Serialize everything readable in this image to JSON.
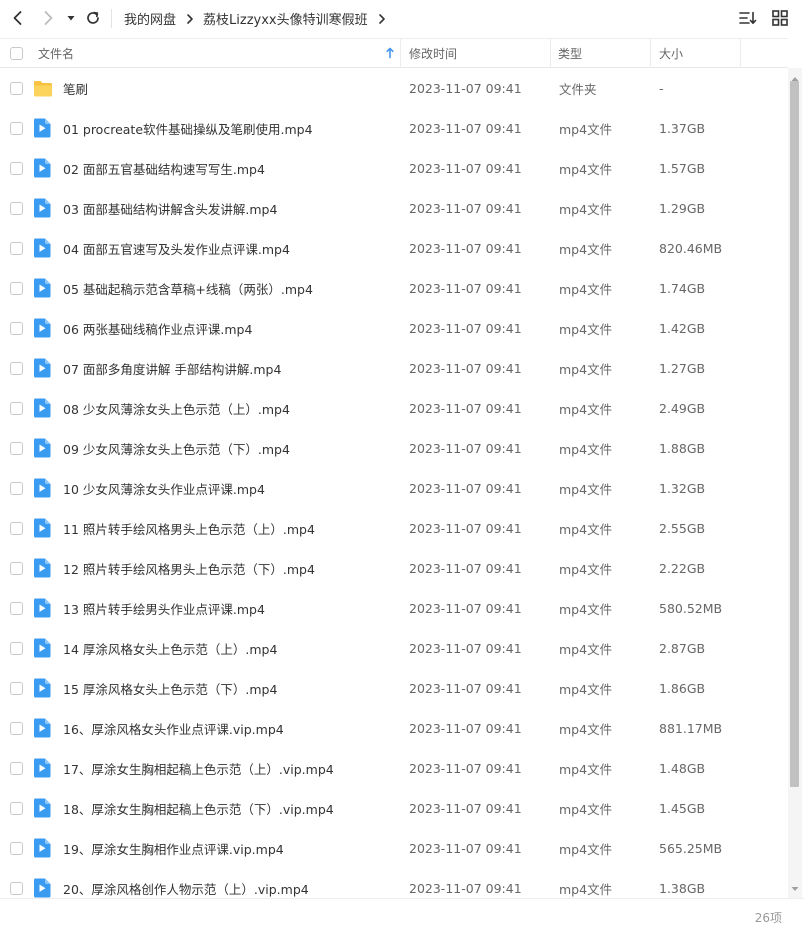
{
  "nav": {
    "breadcrumb": [
      "我的网盘",
      "荔枝Lizzyxx头像特训寒假班"
    ]
  },
  "columns": {
    "name": "文件名",
    "modified": "修改时间",
    "type": "类型",
    "size": "大小"
  },
  "files": [
    {
      "kind": "folder",
      "name": "笔刷",
      "modified": "2023-11-07 09:41",
      "type": "文件夹",
      "size": "-"
    },
    {
      "kind": "video",
      "name": "01 procreate软件基础操纵及笔刷使用.mp4",
      "modified": "2023-11-07 09:41",
      "type": "mp4文件",
      "size": "1.37GB"
    },
    {
      "kind": "video",
      "name": "02 面部五官基础结构速写写生.mp4",
      "modified": "2023-11-07 09:41",
      "type": "mp4文件",
      "size": "1.57GB"
    },
    {
      "kind": "video",
      "name": "03 面部基础结构讲解含头发讲解.mp4",
      "modified": "2023-11-07 09:41",
      "type": "mp4文件",
      "size": "1.29GB"
    },
    {
      "kind": "video",
      "name": "04 面部五官速写及头发作业点评课.mp4",
      "modified": "2023-11-07 09:41",
      "type": "mp4文件",
      "size": "820.46MB"
    },
    {
      "kind": "video",
      "name": "05 基础起稿示范含草稿+线稿（两张）.mp4",
      "modified": "2023-11-07 09:41",
      "type": "mp4文件",
      "size": "1.74GB"
    },
    {
      "kind": "video",
      "name": "06 两张基础线稿作业点评课.mp4",
      "modified": "2023-11-07 09:41",
      "type": "mp4文件",
      "size": "1.42GB"
    },
    {
      "kind": "video",
      "name": "07 面部多角度讲解 手部结构讲解.mp4",
      "modified": "2023-11-07 09:41",
      "type": "mp4文件",
      "size": "1.27GB"
    },
    {
      "kind": "video",
      "name": "08 少女风薄涂女头上色示范（上）.mp4",
      "modified": "2023-11-07 09:41",
      "type": "mp4文件",
      "size": "2.49GB"
    },
    {
      "kind": "video",
      "name": "09 少女风薄涂女头上色示范（下）.mp4",
      "modified": "2023-11-07 09:41",
      "type": "mp4文件",
      "size": "1.88GB"
    },
    {
      "kind": "video",
      "name": "10 少女风薄涂女头作业点评课.mp4",
      "modified": "2023-11-07 09:41",
      "type": "mp4文件",
      "size": "1.32GB"
    },
    {
      "kind": "video",
      "name": "11 照片转手绘风格男头上色示范（上）.mp4",
      "modified": "2023-11-07 09:41",
      "type": "mp4文件",
      "size": "2.55GB"
    },
    {
      "kind": "video",
      "name": "12 照片转手绘风格男头上色示范（下）.mp4",
      "modified": "2023-11-07 09:41",
      "type": "mp4文件",
      "size": "2.22GB"
    },
    {
      "kind": "video",
      "name": "13 照片转手绘男头作业点评课.mp4",
      "modified": "2023-11-07 09:41",
      "type": "mp4文件",
      "size": "580.52MB"
    },
    {
      "kind": "video",
      "name": "14 厚涂风格女头上色示范（上）.mp4",
      "modified": "2023-11-07 09:41",
      "type": "mp4文件",
      "size": "2.87GB"
    },
    {
      "kind": "video",
      "name": "15 厚涂风格女头上色示范（下）.mp4",
      "modified": "2023-11-07 09:41",
      "type": "mp4文件",
      "size": "1.86GB"
    },
    {
      "kind": "video",
      "name": "16、厚涂风格女头作业点评课.vip.mp4",
      "modified": "2023-11-07 09:41",
      "type": "mp4文件",
      "size": "881.17MB"
    },
    {
      "kind": "video",
      "name": "17、厚涂女生胸相起稿上色示范（上）.vip.mp4",
      "modified": "2023-11-07 09:41",
      "type": "mp4文件",
      "size": "1.48GB"
    },
    {
      "kind": "video",
      "name": "18、厚涂女生胸相起稿上色示范（下）.vip.mp4",
      "modified": "2023-11-07 09:41",
      "type": "mp4文件",
      "size": "1.45GB"
    },
    {
      "kind": "video",
      "name": "19、厚涂女生胸相作业点评课.vip.mp4",
      "modified": "2023-11-07 09:41",
      "type": "mp4文件",
      "size": "565.25MB"
    },
    {
      "kind": "video",
      "name": "20、厚涂风格创作人物示范（上）.vip.mp4",
      "modified": "2023-11-07 09:41",
      "type": "mp4文件",
      "size": "1.38GB"
    }
  ],
  "footer": {
    "item_count": "26项"
  },
  "colors": {
    "video_icon": "#3a9bf0",
    "folder_icon": "#f7c241",
    "sort_arrow": "#4596f0"
  },
  "icons": {
    "back": "chevron-left-icon",
    "forward": "chevron-right-icon",
    "history": "caret-down-icon",
    "refresh": "refresh-icon",
    "sort": "sort-lines-icon",
    "grid": "grid-view-icon",
    "folder": "folder-icon",
    "video": "video-file-icon"
  }
}
